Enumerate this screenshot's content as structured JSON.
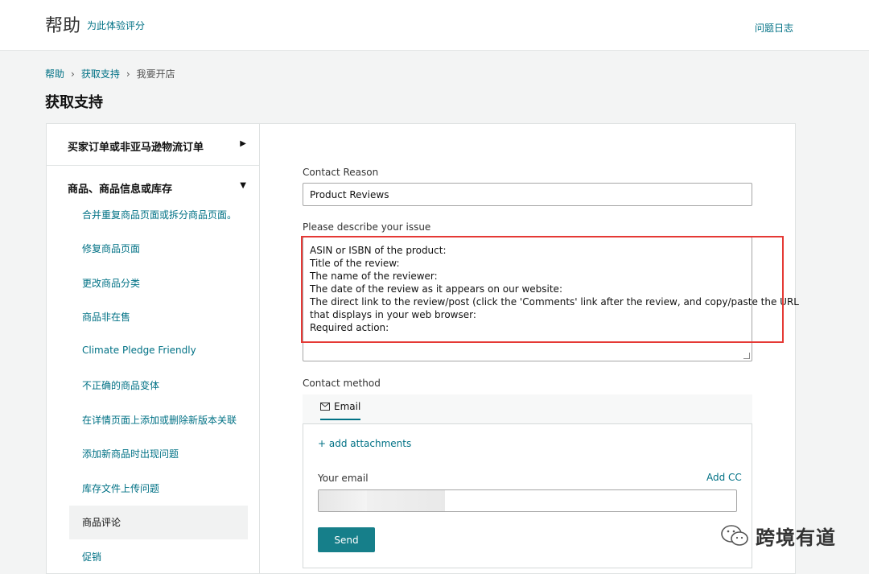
{
  "header": {
    "title": "帮助",
    "rate_link": "为此体验评分",
    "log_link": "问题日志"
  },
  "breadcrumb": [
    "帮助",
    "获取支持",
    "我要开店"
  ],
  "page_title": "获取支持",
  "sidebar": {
    "sections": [
      {
        "label": "买家订单或非亚马逊物流订单",
        "expanded": false
      },
      {
        "label": "商品、商品信息或库存",
        "expanded": true
      }
    ],
    "items": [
      "合并重复商品页面或拆分商品页面。",
      "修复商品页面",
      "更改商品分类",
      "商品非在售",
      "Climate Pledge Friendly",
      "不正确的商品变体",
      "在详情页面上添加或删除新版本关联",
      "添加新商品时出现问题",
      "库存文件上传问题",
      "商品评论",
      "促销"
    ],
    "selected": "商品评论"
  },
  "form": {
    "contact_reason_label": "Contact Reason",
    "contact_reason_value": "Product Reviews",
    "describe_label": "Please describe your issue",
    "describe_lines": [
      "ASIN or ISBN of the product:",
      "Title of the review:",
      "The name of the reviewer:",
      "The date of the review as it appears on our website:",
      "The direct link to the review/post (click the 'Comments' link after the review, and copy/paste the URL",
      "that displays in your web browser:",
      "Required action:"
    ],
    "contact_method_label": "Contact method",
    "email_tab": "Email",
    "add_attachments": "+ add attachments",
    "your_email_label": "Your email",
    "add_cc": "Add CC",
    "send_label": "Send"
  },
  "watermark": "跨境有道",
  "colors": {
    "link": "#007185",
    "button": "#167f8a",
    "highlight": "#e53935"
  }
}
